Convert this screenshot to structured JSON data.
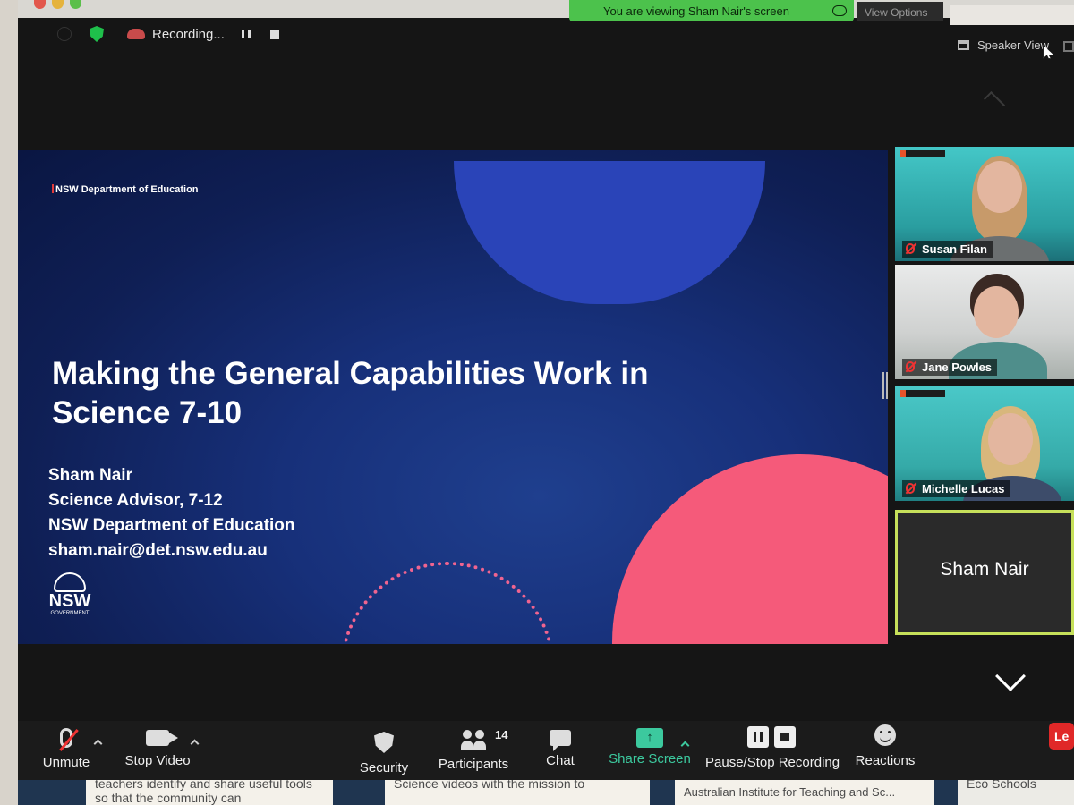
{
  "banner": {
    "text": "You are viewing Sham Nair's screen",
    "view_options": "View Options"
  },
  "recording": {
    "status": "Recording..."
  },
  "view": {
    "mode": "Speaker View"
  },
  "slide": {
    "org": "NSW Department of Education",
    "title_line1": "Making the General Capabilities Work in",
    "title_line2": "Science 7-10",
    "presenter": "Sham Nair",
    "role": "Science Advisor, 7-12",
    "department": "NSW Department of Education",
    "email": "sham.nair@det.nsw.edu.au",
    "logo_text": "NSW",
    "logo_sub": "GOVERNMENT"
  },
  "participants": [
    {
      "name": "Susan Filan",
      "muted": true
    },
    {
      "name": "Jane Powles",
      "muted": true
    },
    {
      "name": "Michelle Lucas",
      "muted": true
    },
    {
      "name": "Sham Nair",
      "muted": false
    }
  ],
  "toolbar": {
    "unmute": "Unmute",
    "stop_video": "Stop Video",
    "security": "Security",
    "participants": "Participants",
    "participants_count": "14",
    "chat": "Chat",
    "share_screen": "Share Screen",
    "pause_stop_recording": "Pause/Stop Recording",
    "reactions": "Reactions",
    "leave": "Le"
  },
  "background_page": {
    "card1": "teachers identify and share useful tools so that the community can",
    "card2": "Science videos with the mission to",
    "card3": "Australian Institute for Teaching and Sc...",
    "card4": "Eco Schools"
  },
  "colors": {
    "share_banner": "#4cc24c",
    "share_icon": "#3cc99e",
    "leave": "#e02828",
    "active_speaker_border": "#c6e05a",
    "slide_pink": "#f55a7a",
    "slide_blue": "#2a44b8"
  }
}
